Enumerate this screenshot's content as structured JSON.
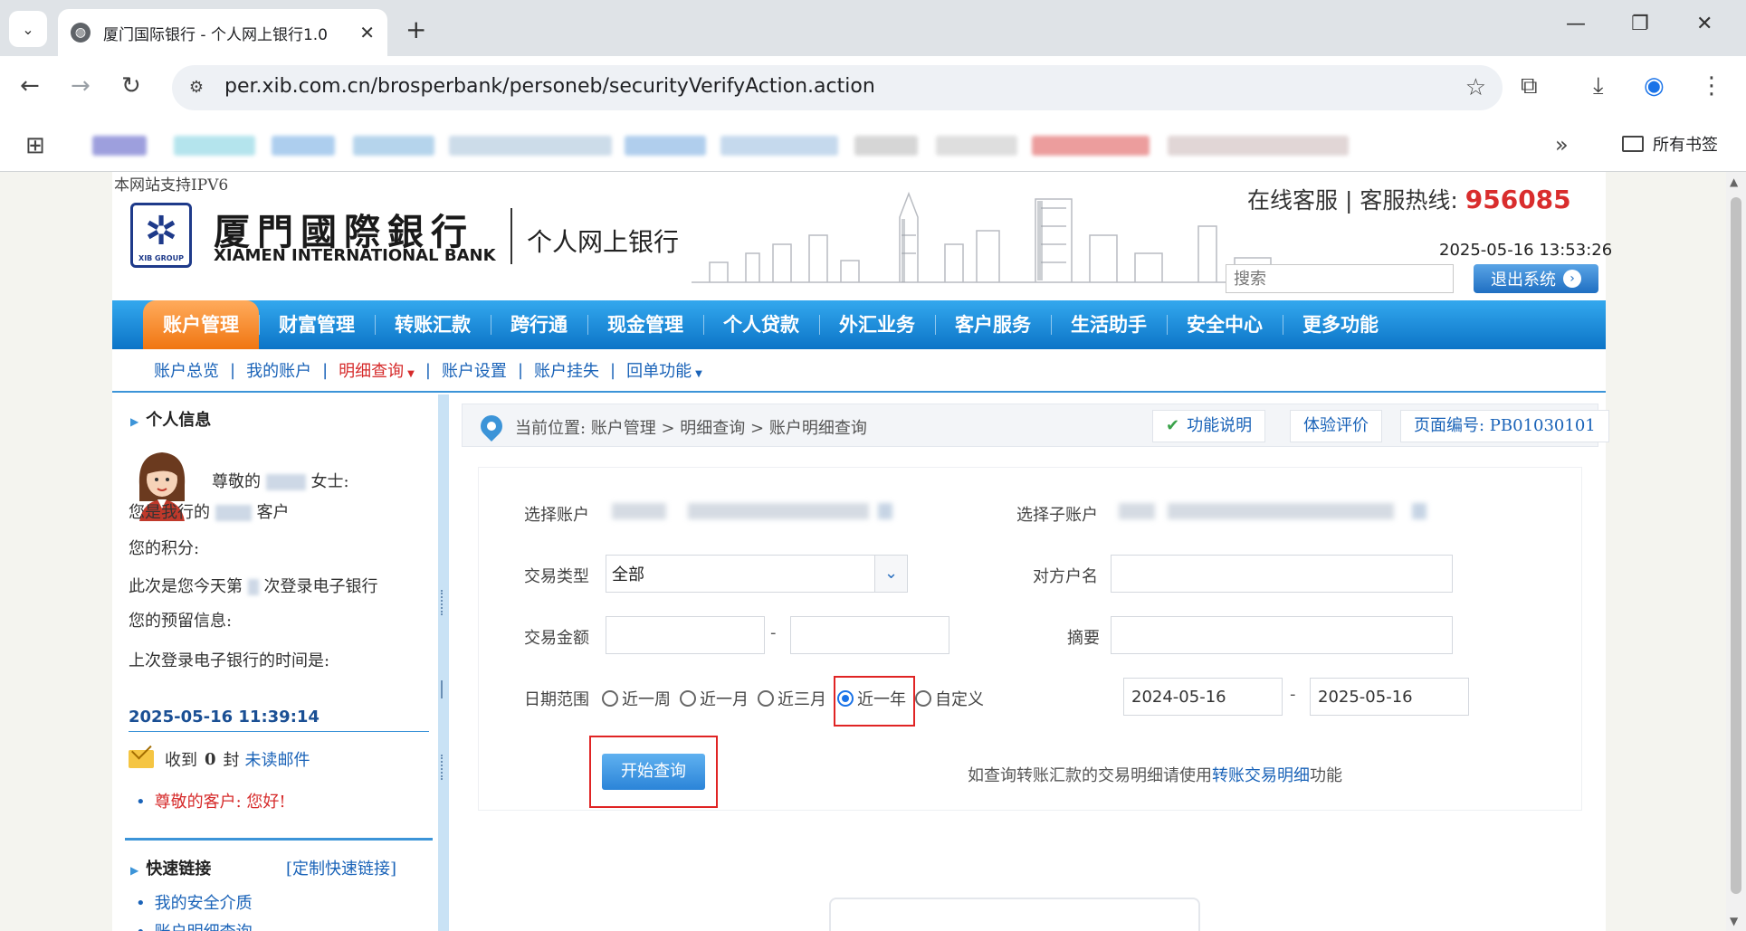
{
  "browser": {
    "tab_title": "厦门国际银行 - 个人网上银行1.0",
    "url": "per.xib.com.cn/brosperbank/personeb/securityVerifyAction.action",
    "bookmarks_all_label": "所有书签"
  },
  "header": {
    "ipv6_note": "本网站支持IPV6",
    "bank_name_cn": "厦門國際銀行",
    "bank_name_en": "XIAMEN INTERNATIONAL BANK",
    "logo_group_text": "XIB GROUP",
    "subtitle": "个人网上银行",
    "service_label": "在线客服 | 客服热线:",
    "hotline_number": "956085",
    "datetime": "2025-05-16 13:53:26",
    "search_placeholder": "搜索",
    "logout_label": "退出系统"
  },
  "main_nav": [
    "账户管理",
    "财富管理",
    "转账汇款",
    "跨行通",
    "现金管理",
    "个人贷款",
    "外汇业务",
    "客户服务",
    "生活助手",
    "安全中心",
    "更多功能"
  ],
  "main_nav_active": "账户管理",
  "sub_nav": {
    "overview": "账户总览",
    "my_accounts": "我的账户",
    "detail_query": "明细查询",
    "settings": "账户设置",
    "loss_report": "账户挂失",
    "receipt": "回单功能"
  },
  "sidebar": {
    "personal_info_title": "个人信息",
    "greeting_prefix": "尊敬的",
    "greeting_suffix": "女士:",
    "customer_prefix": "您是我行的",
    "customer_suffix": "客户",
    "points_label": "您的积分:",
    "login_count_prefix": "此次是您今天第",
    "login_count_suffix": "次登录电子银行",
    "reserved_info_label": "您的预留信息:",
    "last_login_label": "上次登录电子银行的时间是:",
    "last_login_time": "2025-05-16 11:39:14",
    "mail_prefix": "收到",
    "mail_count": "0",
    "mail_unit": "封",
    "mail_link": "未读邮件",
    "welcome": "尊敬的客户: 您好!",
    "quick_links_title": "快速链接",
    "quick_links_custom": "[定制快速链接]",
    "quick_links": [
      "我的安全介质",
      "账户明细查询"
    ]
  },
  "breadcrumb": {
    "text": "当前位置: 账户管理 > 明细查询 > 账户明细查询",
    "help": "功能说明",
    "feedback": "体验评价",
    "page_code": "页面编号: PB01030101"
  },
  "form": {
    "select_account_label": "选择账户",
    "select_subaccount_label": "选择子账户",
    "txn_type_label": "交易类型",
    "txn_type_value": "全部",
    "counterparty_label": "对方户名",
    "amount_label": "交易金额",
    "amount_sep": "-",
    "summary_label": "摘要",
    "date_range_label": "日期范围",
    "date_options": [
      "近一周",
      "近一月",
      "近三月",
      "近一年",
      "自定义"
    ],
    "date_selected": "近一年",
    "start_date": "2024-05-16",
    "end_date": "2025-05-16",
    "date_sep": "-",
    "query_button": "开始查询",
    "tip_prefix": "如查询转账汇款的交易明细请使用",
    "tip_link": "转账交易明细",
    "tip_suffix": "功能"
  }
}
